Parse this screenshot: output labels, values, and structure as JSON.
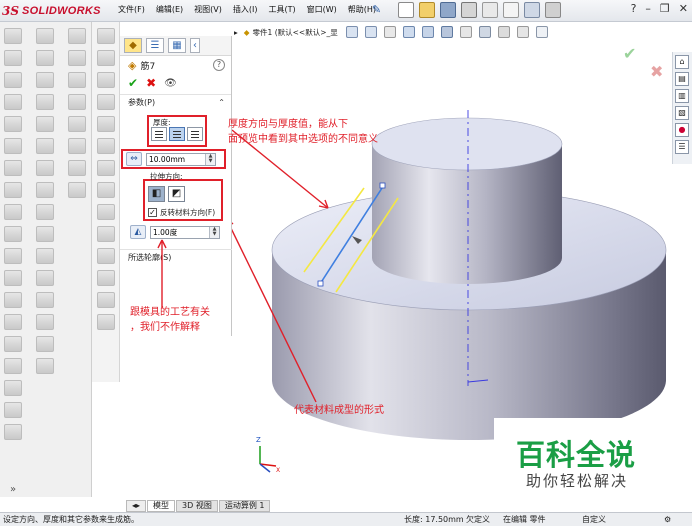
{
  "app": {
    "logo_ds": "3S",
    "logo_brand": "SOLIDWORKS"
  },
  "menu": [
    "文件(F)",
    "编辑(E)",
    "视图(V)",
    "插入(I)",
    "工具(T)",
    "窗口(W)",
    "帮助(H)"
  ],
  "view_bar": {
    "document_label": "零件1 (默认<<默认>_显"
  },
  "property_manager": {
    "feature_title": "筋7",
    "help_glyph": "?",
    "params_group": "参数(P)",
    "thickness_label": "厚度:",
    "thickness_value": "10.00mm",
    "extrude_direction_label": "拉伸方向:",
    "flip_material_label": "反转材料方向(F)",
    "flip_material_checked": true,
    "draft_value": "1.00度",
    "selected_contours_group": "所选轮廓(S)"
  },
  "annotations": {
    "thickness_note_line1": "厚度方向与厚度值，能从下",
    "thickness_note_line2": "面预览中看到其中选项的不同意义",
    "mold_note_line1": "跟模具的工艺有关",
    "mold_note_line2": "，我们不作解释",
    "material_note": "代表材料成型的形式"
  },
  "watermark": {
    "title": "百科全说",
    "subtitle": "助你轻松解决"
  },
  "bottom_tabs": [
    "模型",
    "3D 视图",
    "运动算例 1"
  ],
  "status_bar": {
    "message": "设定方向、厚度和其它参数来生成筋。",
    "length": "长度: 17.50mm",
    "undefined": "欠定义",
    "editing": "在编辑 零件",
    "custom": "自定义"
  },
  "colors": {
    "accent_red": "#e0202a",
    "watermark_green": "#1a9e45",
    "preview_yellow": "#f4e842",
    "preview_blue": "#3f7fe0"
  }
}
